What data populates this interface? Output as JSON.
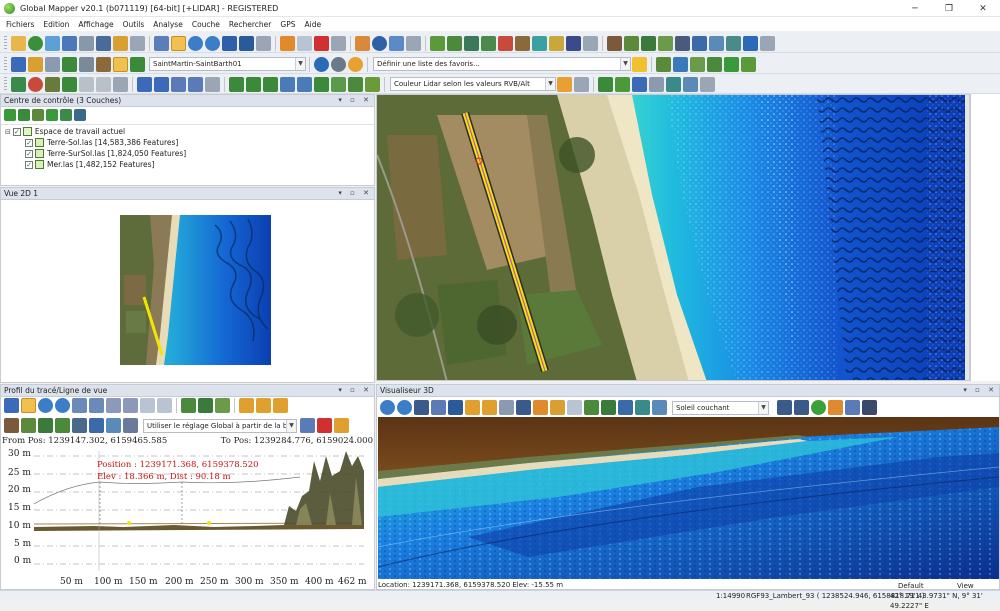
{
  "window": {
    "title": "Global Mapper v20.1 (b071119) [64-bit] [+LIDAR] - REGISTERED",
    "controls": [
      "─",
      "❐",
      "✕"
    ]
  },
  "menu": [
    "Fichiers",
    "Edition",
    "Affichage",
    "Outils",
    "Analyse",
    "Couche",
    "Rechercher",
    "GPS",
    "Aide"
  ],
  "toolbar": {
    "config_combo": "SaintMartin-SaintBarth01",
    "favorites_combo": "Définir une liste des favoris...",
    "lidar_color_combo": "Couleur Lidar selon les valeurs RVB/Alt"
  },
  "control_center": {
    "title": "Centre de contrôle (3 Couches)",
    "root": "Espace de travail actuel",
    "layers": [
      "Terre-Sol.las [14,583,386 Features]",
      "Terre-SurSol.las [1,824,050 Features]",
      "Mer.las [1,482,152 Features]"
    ]
  },
  "view2d": {
    "title": "Vue 2D 1"
  },
  "profile": {
    "title": "Profil du tracé/Ligne de vue",
    "global_setting_combo": "Utiliser le réglage Global à partir de la barre d'o",
    "from_pos": "From Pos: 1239147.302, 6159465.585",
    "to_pos": "To Pos: 1239284.776, 6159024.000",
    "position_label": "Position : 1239171.368, 6159378.520",
    "elev_label": "Elev : 18.366 m, Dist : 90.18 m",
    "y_ticks": [
      "30 m",
      "25 m",
      "20 m",
      "15 m",
      "10 m",
      "5 m",
      "0 m"
    ],
    "x_ticks": [
      "50 m",
      "100 m",
      "150 m",
      "200 m",
      "250 m",
      "300 m",
      "350 m",
      "400 m",
      "462 m"
    ]
  },
  "viewer3d": {
    "title": "Visualiseur 3D",
    "lighting_combo": "Soleil couchant",
    "location": "Location: 1239171.368, 6159378.520 Elev: -15.55 m"
  },
  "statusbar": {
    "default": "Default",
    "view": "View",
    "scale": "1:14990",
    "projection": "RGF93_Lambert_93 ( 1238524.946, 6158818.711 )",
    "latlon": "42° 19' 43.9731\" N, 9° 31' 49.2227\" E"
  },
  "colors": {
    "panel_header": "#dde3ec",
    "toolbar": "#eceff4",
    "profile_annotation": "#cc1111",
    "track_line": "#f2e600"
  }
}
